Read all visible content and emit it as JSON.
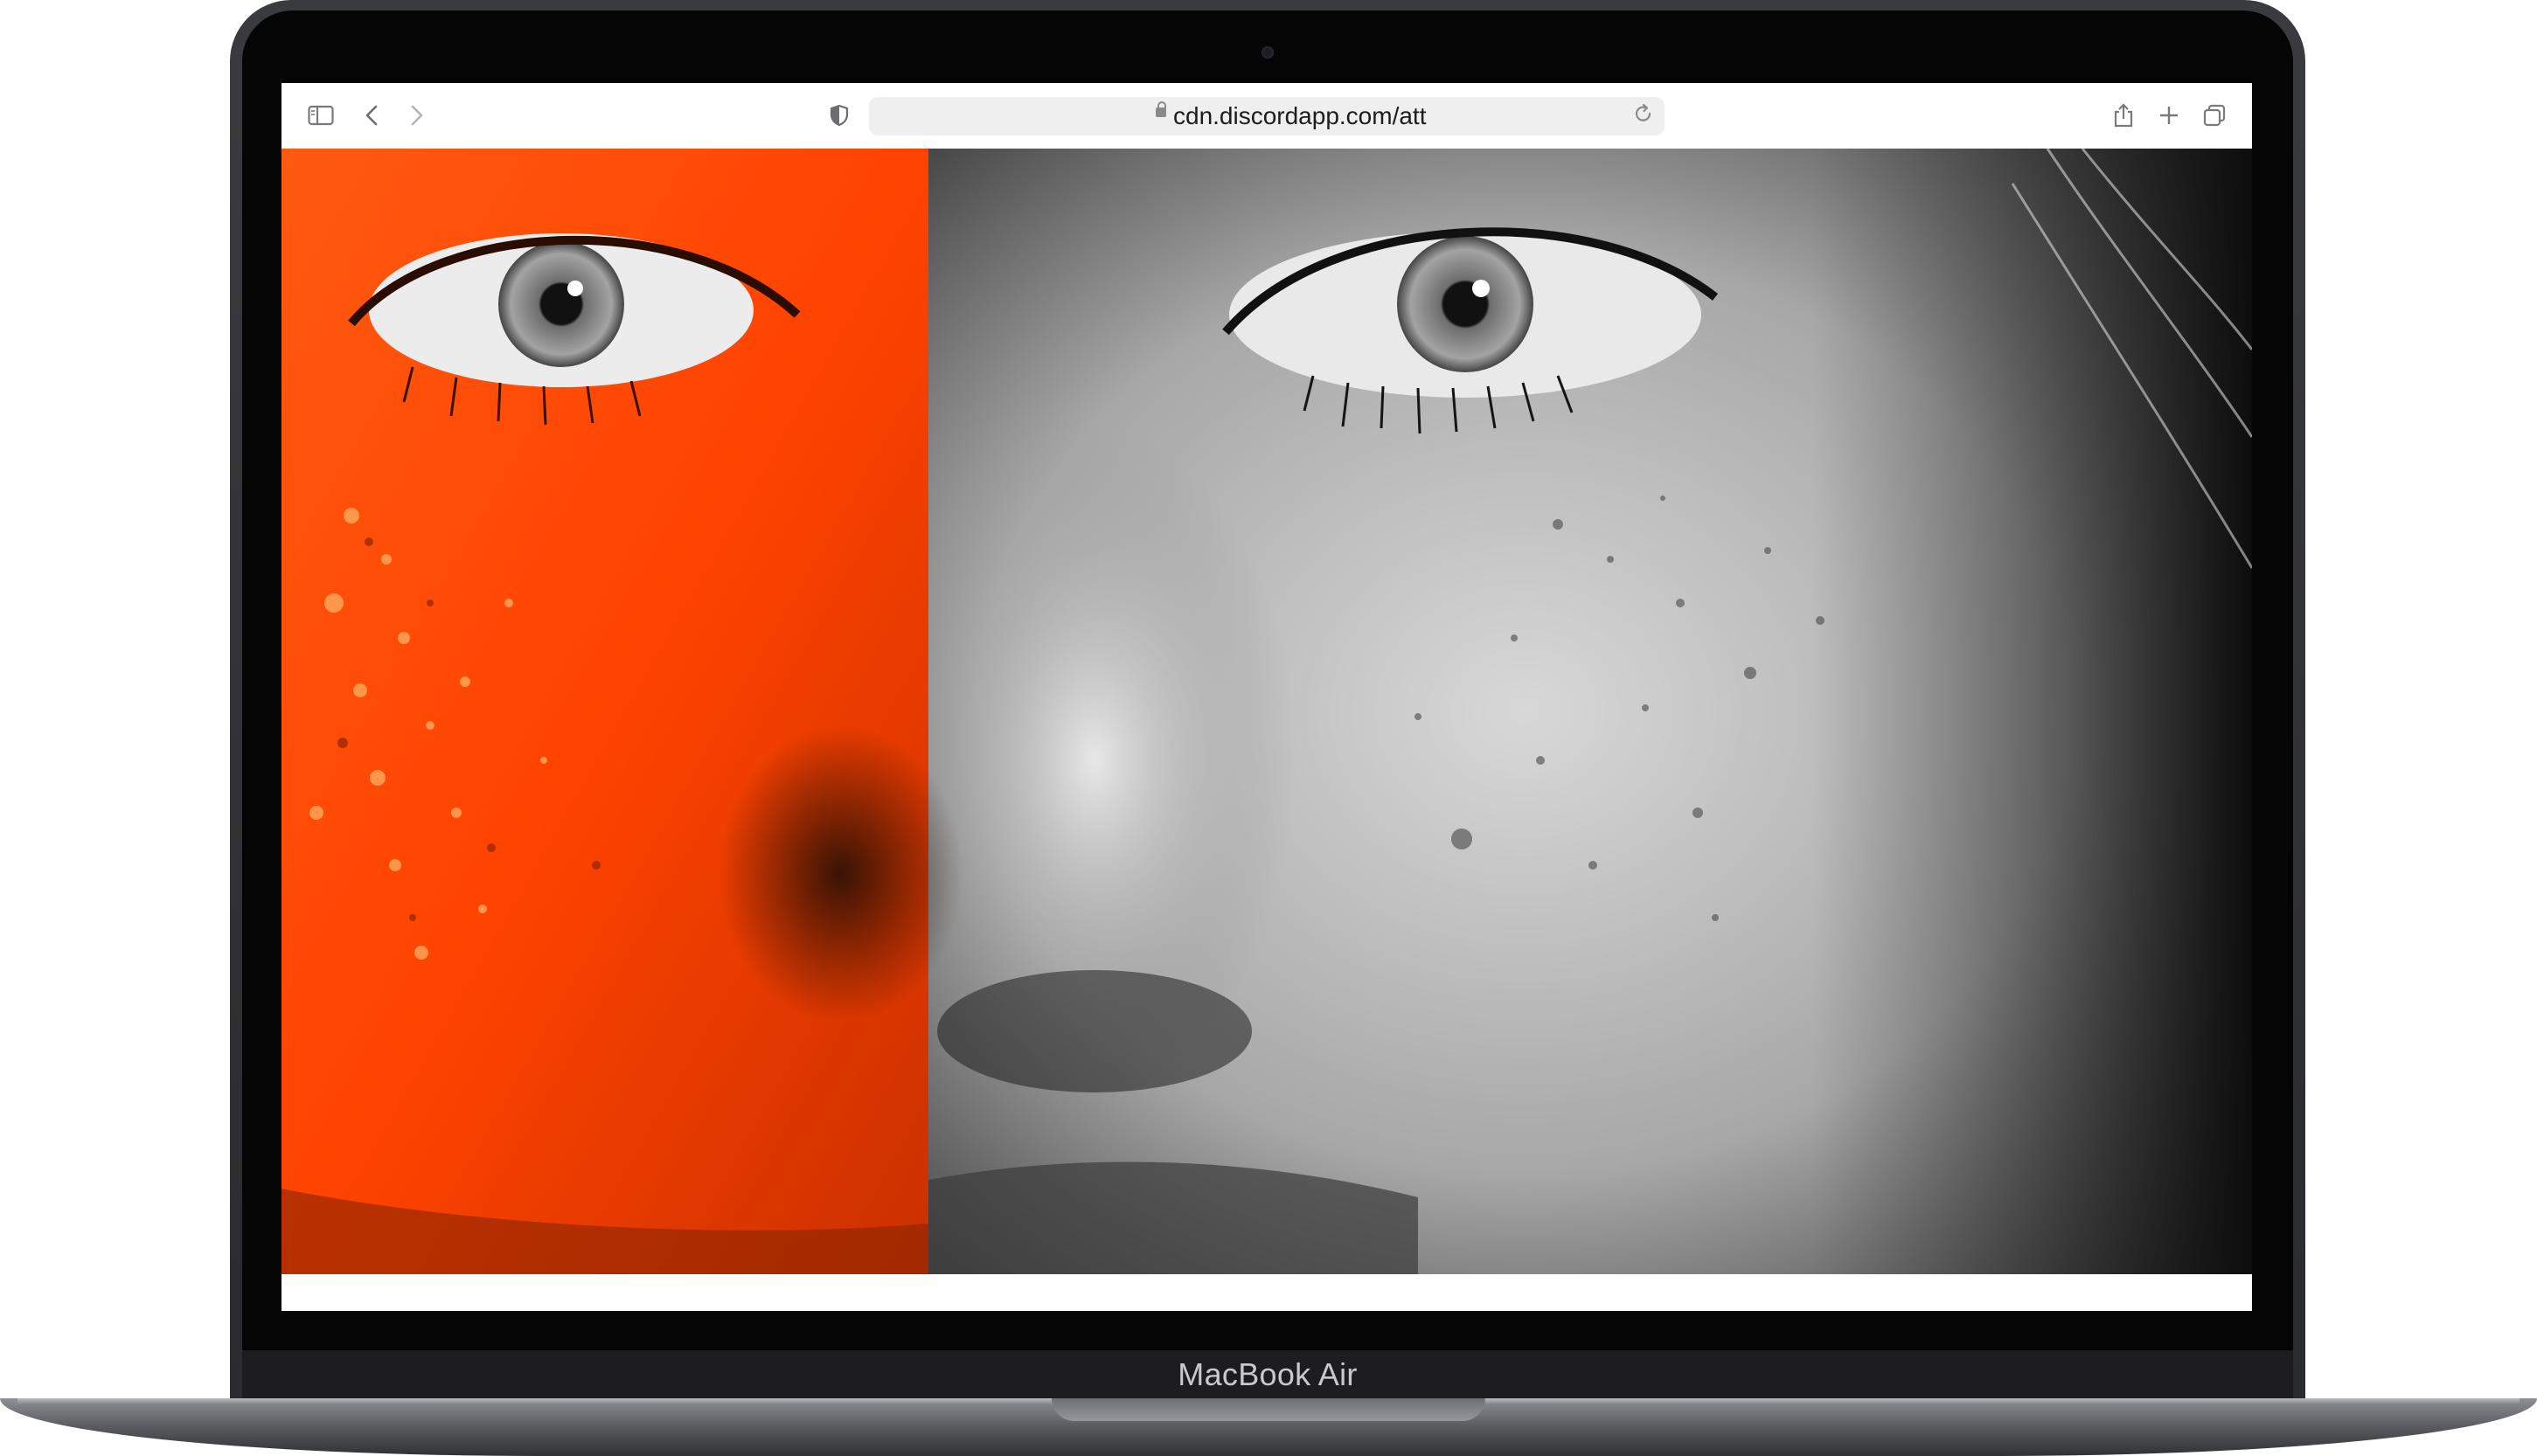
{
  "device": {
    "model_label": "MacBook Air"
  },
  "browser": {
    "address_bar": {
      "url": "cdn.discordapp.com/att"
    },
    "icons": [
      "sidebar-icon",
      "back-icon",
      "forward-icon",
      "shield-icon",
      "lock-icon",
      "reload-icon",
      "share-icon",
      "new-tab-icon",
      "tabs-overview-icon"
    ]
  },
  "content": {
    "image": "portrait split: left half orange-tinted skin with eye, right half black-and-white freckled face with eye",
    "colors": {
      "orange": "#ff4a00",
      "grayscale_light": "#d9d9d9",
      "grayscale_dark": "#1a1a1a"
    }
  }
}
